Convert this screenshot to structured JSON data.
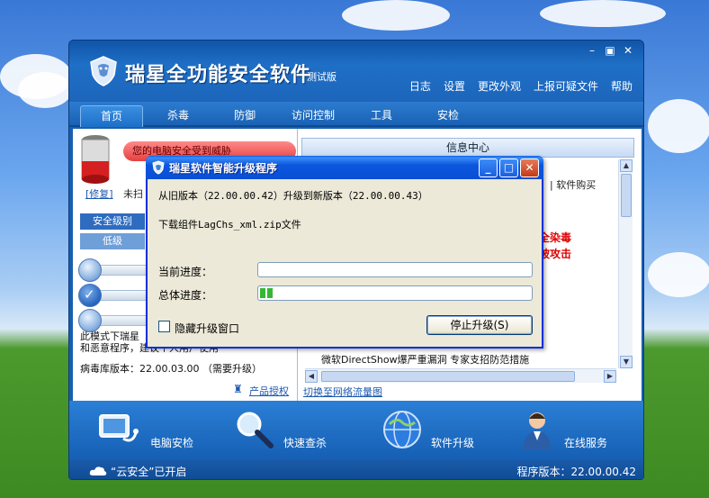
{
  "app": {
    "title": "瑞星全功能安全软件",
    "edition": "测试版",
    "top_links": [
      "日志",
      "设置",
      "更改外观",
      "上报可疑文件",
      "帮助"
    ],
    "nav_tabs": [
      "首页",
      "杀毒",
      "防御",
      "访问控制",
      "工具",
      "安检"
    ],
    "active_tab": "首页"
  },
  "left_panel": {
    "status_text": "您的电脑安全受到威胁",
    "fix_link": "[修复]",
    "fix_text": "未扫",
    "security_level_label": "安全级别",
    "level_low": "低级",
    "mode_desc": "此模式下瑞星\n和恶意程序，建议个人用户使用",
    "db_version": "病毒库版本：22.00.03.00 （需要升级）",
    "license_link": "产品授权"
  },
  "right_panel": {
    "header": "信息中心",
    "buy_link": "| 软件购买",
    "alert1": "全染毒",
    "alert2": "被攻击",
    "qmark": "?",
    "news": "微软DirectShow爆严重漏洞 专家支招防范措施",
    "switch_link": "切换至网络流量图"
  },
  "launcher": {
    "items": [
      "电脑安检",
      "快速查杀",
      "软件升级",
      "在线服务"
    ]
  },
  "statusbar": {
    "cloud": "“云安全”已开启",
    "program_version": "程序版本：22.00.00.42"
  },
  "dialog": {
    "title": "瑞星软件智能升级程序",
    "upgrade_msg": "从旧版本（22.00.00.42）升级到新版本（22.00.00.43）",
    "download_msg": "下载组件LagChs_xml.zip文件",
    "current_label": "当前进度：",
    "total_label": "总体进度：",
    "current_progress": 0,
    "total_progress": 0.05,
    "hide_label": "隐藏升级窗口",
    "stop_button": "停止升级(S)"
  }
}
